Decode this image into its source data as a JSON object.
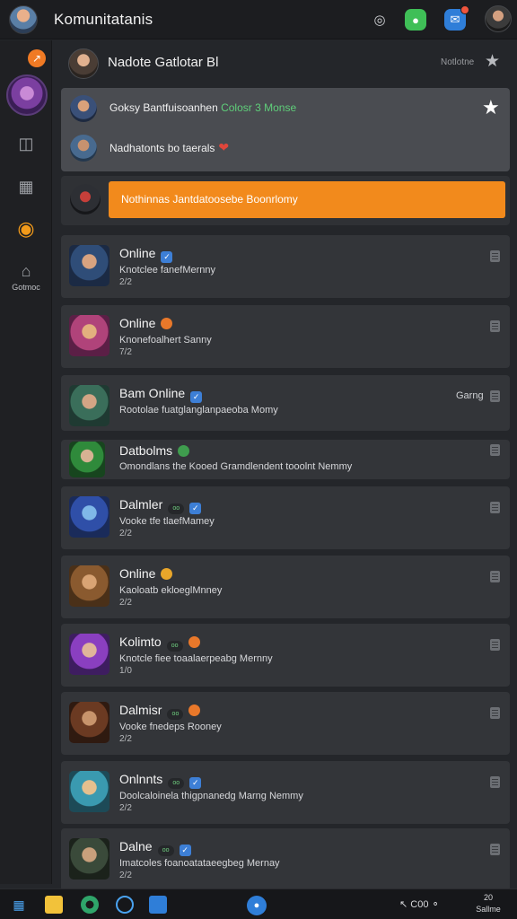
{
  "app": {
    "title": "Komunitatanis"
  },
  "titlebar": {
    "icons": [
      "target-icon",
      "chat-icon",
      "notification-icon",
      "user-avatar"
    ]
  },
  "sidebar": {
    "badge": "↗",
    "items": [
      {
        "icon": "clipboard-icon"
      },
      {
        "icon": "calendar-icon"
      },
      {
        "icon": "paw-icon"
      },
      {
        "icon": "home-icon",
        "label": "Gotmoc"
      }
    ]
  },
  "header": {
    "title": "Nadote Gatlotar Bl",
    "status": "Notlotne"
  },
  "featured": {
    "line1_text": "Goksy Bantfuisoanhen ",
    "line1_accent": "Colosr 3 Monse",
    "line2_text": "Nadhatonts bo taerals"
  },
  "banner": {
    "text": "Nothinnas Jantdatoosebe Boonrlomy"
  },
  "cards": [
    {
      "name": "Online",
      "badge": "blue",
      "desc": "Knotclee fanefMernny",
      "meta": "2/2"
    },
    {
      "name": "Online",
      "badge": "orange",
      "desc": "Knonefoalhert Sanny",
      "meta": "7/2"
    },
    {
      "name": "Bam Online",
      "badge": "blue",
      "desc": "Rootolae fuatglanglanpaeoba Momy",
      "meta": "",
      "tag": "Garng"
    },
    {
      "name": "Datbolms",
      "badge": "green",
      "desc": "Omondlans the Kooed Gramdlendent tooolnt Nemmy",
      "meta": ""
    },
    {
      "name": "Dalmler",
      "badge": "blue",
      "pill": "oo",
      "desc": "Vooke tfe tlaefMamey",
      "meta": "2/2"
    },
    {
      "name": "Online",
      "badge": "gold",
      "desc": "Kaoloatb ekloeglMnney",
      "meta": "2/2"
    },
    {
      "name": "Kolimto",
      "badge": "orange",
      "pill": "oo",
      "desc": "Knotcle fiee toaalaerpeabg Mernny",
      "meta": "1/0"
    },
    {
      "name": "Dalmisr",
      "badge": "orange",
      "pill": "oo",
      "desc": "Vooke fnedeps Rooney",
      "meta": "2/2"
    },
    {
      "name": "Onlnnts",
      "badge": "blue",
      "pill": "oo",
      "desc": "Doolcaloinela thigpnanedg Marng Nemmy",
      "meta": "2/2"
    },
    {
      "name": "Dalne",
      "badge": "blue",
      "pill": "oo",
      "desc": "Imatcoles foanoatataeegbeg Mernay",
      "meta": "2/2"
    }
  ],
  "taskbar": {
    "tray": "↖ C00 ⚬",
    "time": "20",
    "date": "Sallme"
  },
  "colors": {
    "accent": "#f28a1c",
    "background": "#24262a",
    "card": "#333539",
    "featured": "#4a4c51"
  }
}
